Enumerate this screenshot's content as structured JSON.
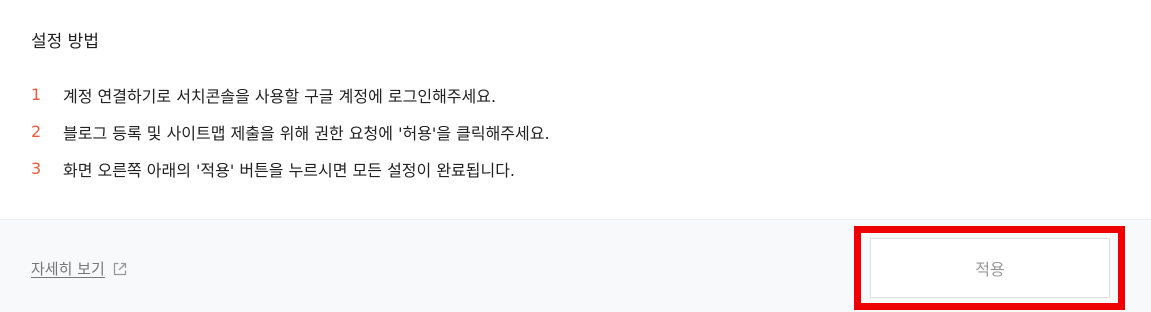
{
  "section": {
    "title": "설정 방법"
  },
  "steps": [
    {
      "number": "1",
      "text": "계정 연결하기로 서치콘솔을 사용할 구글 계정에 로그인해주세요."
    },
    {
      "number": "2",
      "text": "블로그 등록 및 사이트맵 제출을 위해 권한 요청에 '허용'을 클릭해주세요."
    },
    {
      "number": "3",
      "text": "화면 오른쪽 아래의 '적용' 버튼을 누르시면 모든 설정이 완료됩니다."
    }
  ],
  "footer": {
    "detail_link_label": "자세히 보기",
    "detail_link_icon": "external-link-icon",
    "apply_label": "적용"
  },
  "colors": {
    "step_number": "#f05a3c",
    "highlight_border": "#ee0000",
    "footer_background": "#f8f9fb",
    "apply_text": "#9a9a9a"
  }
}
